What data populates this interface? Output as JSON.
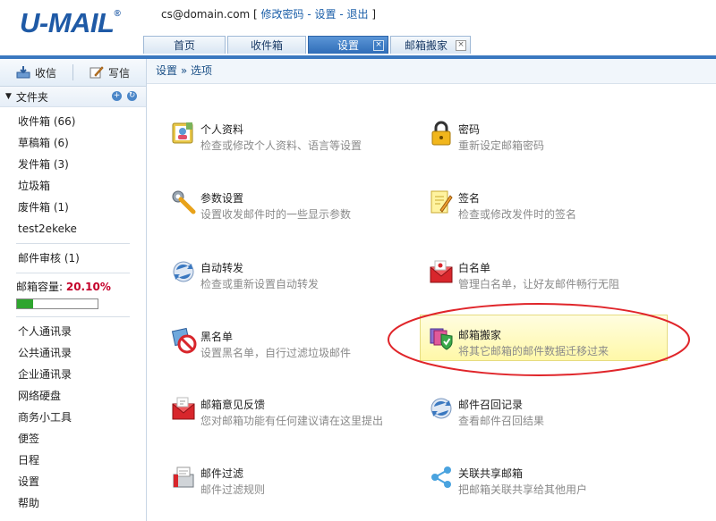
{
  "header": {
    "logo": "U-MAIL",
    "logo_mark": "®",
    "user_email": "cs@domain.com",
    "bracket_open": " [ ",
    "change_password": "修改密码",
    "sep1": " - ",
    "settings_link": "设置",
    "sep2": " - ",
    "logout": "退出",
    "bracket_close": " ]"
  },
  "tabs": [
    {
      "label": "首页",
      "active": false,
      "closable": false
    },
    {
      "label": "收件箱",
      "active": false,
      "closable": false
    },
    {
      "label": "设置",
      "active": true,
      "closable": true
    },
    {
      "label": "邮箱搬家",
      "active": false,
      "closable": true
    }
  ],
  "sidebar": {
    "receive": "收信",
    "compose": "写信",
    "folders_title": "文件夹",
    "folders": [
      "收件箱 (66)",
      "草稿箱 (6)",
      "发件箱 (3)",
      "垃圾箱",
      "废件箱 (1)",
      "test2ekeke"
    ],
    "review": "邮件审核 (1)",
    "quota_label": "邮箱容量: ",
    "quota_value": "20.10%",
    "quota_fraction": 0.201,
    "tools": [
      "个人通讯录",
      "公共通讯录",
      "企业通讯录",
      "网络硬盘",
      "商务小工具",
      "便签",
      "日程",
      "设置",
      "帮助"
    ]
  },
  "breadcrumb": "设置 » 选项",
  "options": [
    {
      "title": "个人资料",
      "desc": "检查或修改个人资料、语言等设置",
      "icon": "profile-icon"
    },
    {
      "title": "密码",
      "desc": "重新设定邮箱密码",
      "icon": "lock-icon"
    },
    {
      "title": "参数设置",
      "desc": "设置收发邮件时的一些显示参数",
      "icon": "wrench-icon"
    },
    {
      "title": "签名",
      "desc": "检查或修改发件时的签名",
      "icon": "note-pencil-icon"
    },
    {
      "title": "自动转发",
      "desc": "检查或重新设置自动转发",
      "icon": "forward-icon"
    },
    {
      "title": "白名单",
      "desc": "管理白名单，让好友邮件畅行无阻",
      "icon": "whitelist-envelope-icon"
    },
    {
      "title": "黑名单",
      "desc": "设置黑名单，自行过滤垃圾邮件",
      "icon": "blacklist-icon"
    },
    {
      "title": "邮箱搬家",
      "desc": "将其它邮箱的邮件数据迁移过来",
      "icon": "migrate-shield-icon"
    },
    {
      "title": "邮箱意见反馈",
      "desc": "您对邮箱功能有任何建议请在这里提出",
      "icon": "feedback-envelope-icon"
    },
    {
      "title": "邮件召回记录",
      "desc": "查看邮件召回结果",
      "icon": "recall-icon"
    },
    {
      "title": "邮件过滤",
      "desc": "邮件过滤规则",
      "icon": "filter-mailbox-icon"
    },
    {
      "title": "关联共享邮箱",
      "desc": "把邮箱关联共享给其他用户",
      "icon": "share-icon"
    }
  ],
  "colors": {
    "accent": "#3a78c0",
    "quota": "#c4002a",
    "highlight_ring": "#e0252a"
  }
}
